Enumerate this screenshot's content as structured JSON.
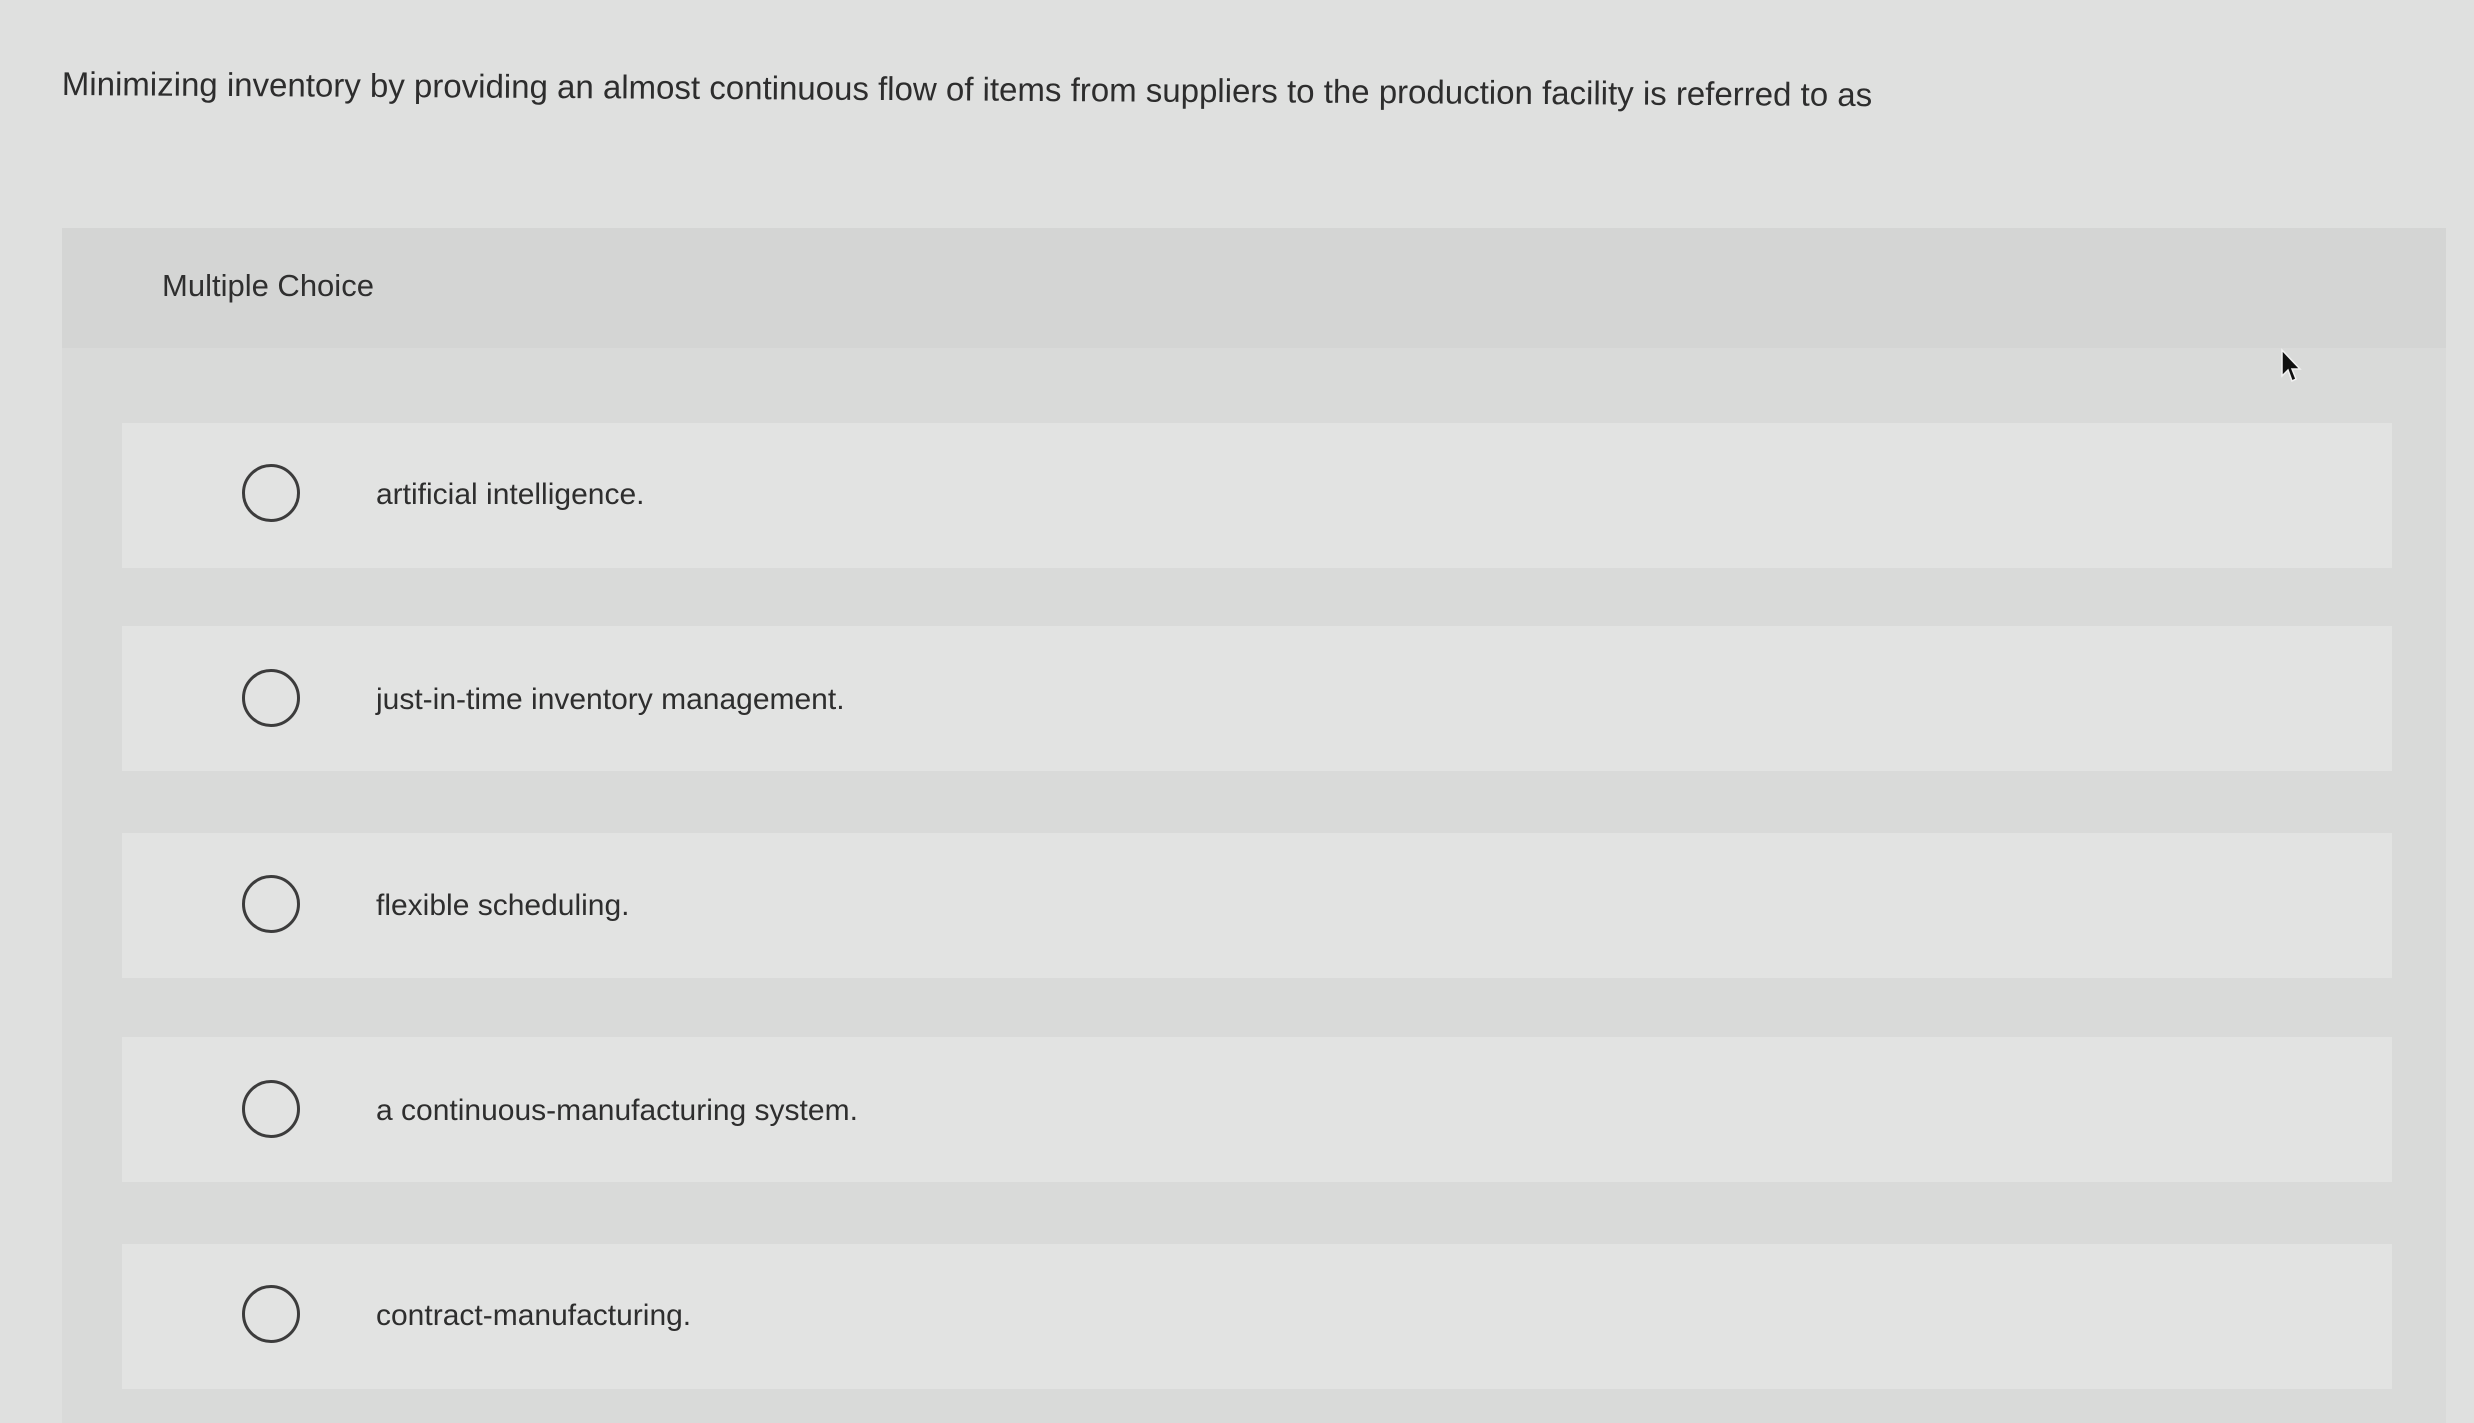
{
  "question": {
    "text": "Minimizing inventory by providing an almost continuous flow of items from suppliers to the production facility is referred to as"
  },
  "panel": {
    "title": "Multiple Choice"
  },
  "choices": [
    {
      "label": "artificial intelligence."
    },
    {
      "label": "just-in-time inventory management."
    },
    {
      "label": "flexible scheduling."
    },
    {
      "label": "a continuous-manufacturing system."
    },
    {
      "label": "contract-manufacturing."
    }
  ],
  "icons": {
    "radio": "radio-circle-icon",
    "cursor": "mouse-pointer-icon"
  },
  "colors": {
    "background": "#dfe0df",
    "panel": "#d9dad9",
    "choice_row": "#e2e3e2",
    "text": "#2d2d2d"
  }
}
